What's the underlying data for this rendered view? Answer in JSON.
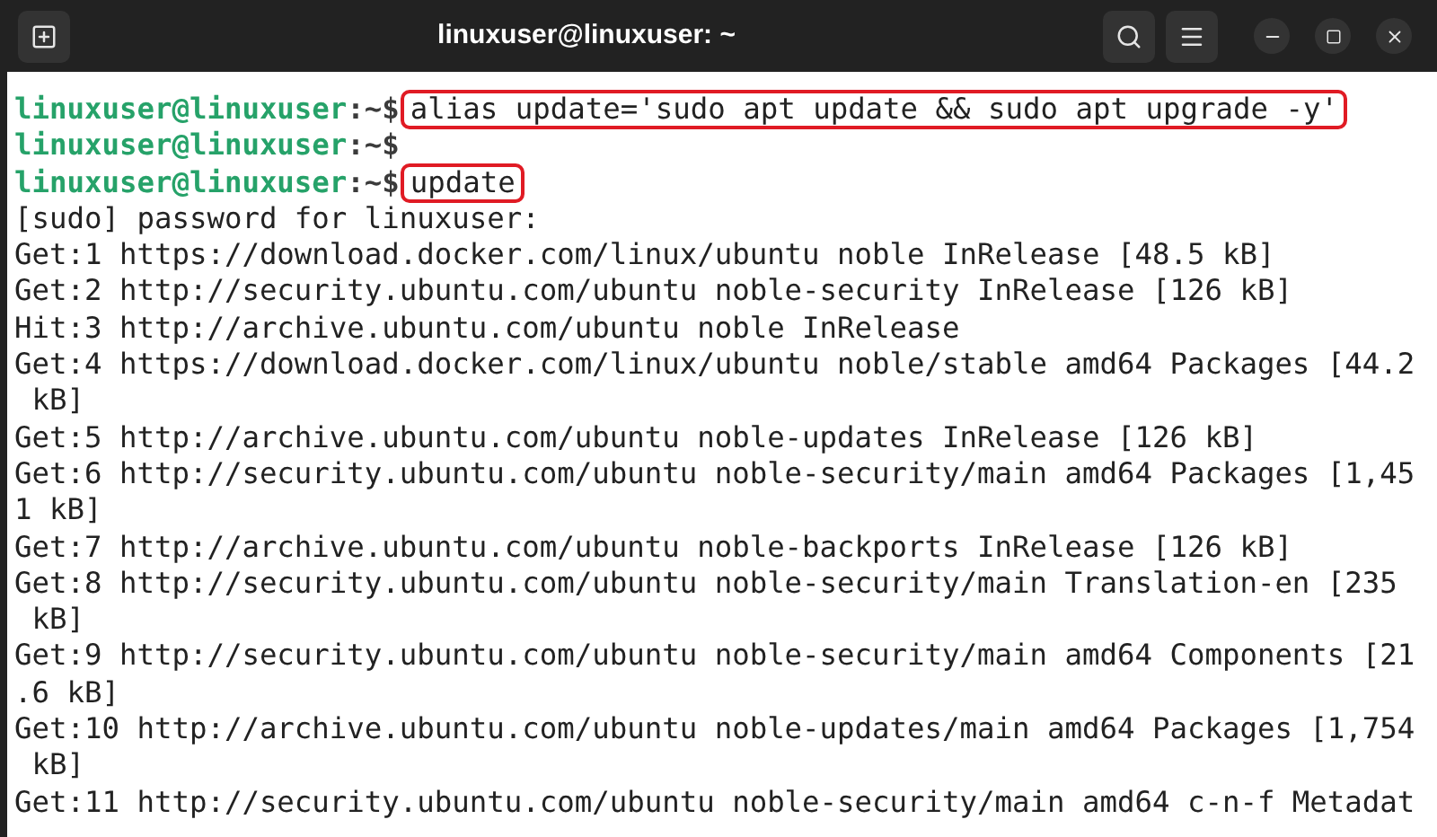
{
  "window": {
    "title": "linuxuser@linuxuser: ~"
  },
  "terminal": {
    "lines": [
      {
        "kind": "prompt",
        "user_host": "linuxuser@linuxuser",
        "path": ":~$",
        "command": "alias update='sudo apt update && sudo apt upgrade -y'",
        "highlighted": true
      },
      {
        "kind": "prompt",
        "user_host": "linuxuser@linuxuser",
        "path": ":~$"
      },
      {
        "kind": "prompt",
        "user_host": "linuxuser@linuxuser",
        "path": ":~$",
        "command": "update",
        "highlighted": true
      },
      {
        "kind": "output",
        "text": "[sudo] password for linuxuser:"
      },
      {
        "kind": "output",
        "text": "Get:1 https://download.docker.com/linux/ubuntu noble InRelease [48.5 kB]"
      },
      {
        "kind": "output",
        "text": "Get:2 http://security.ubuntu.com/ubuntu noble-security InRelease [126 kB]"
      },
      {
        "kind": "output",
        "text": "Hit:3 http://archive.ubuntu.com/ubuntu noble InRelease"
      },
      {
        "kind": "output",
        "text": "Get:4 https://download.docker.com/linux/ubuntu noble/stable amd64 Packages [44.2"
      },
      {
        "kind": "output",
        "text": " kB]"
      },
      {
        "kind": "output",
        "text": "Get:5 http://archive.ubuntu.com/ubuntu noble-updates InRelease [126 kB]"
      },
      {
        "kind": "output",
        "text": "Get:6 http://security.ubuntu.com/ubuntu noble-security/main amd64 Packages [1,45"
      },
      {
        "kind": "output",
        "text": "1 kB]"
      },
      {
        "kind": "output",
        "text": "Get:7 http://archive.ubuntu.com/ubuntu noble-backports InRelease [126 kB]"
      },
      {
        "kind": "output",
        "text": "Get:8 http://security.ubuntu.com/ubuntu noble-security/main Translation-en [235"
      },
      {
        "kind": "output",
        "text": " kB]"
      },
      {
        "kind": "output",
        "text": "Get:9 http://security.ubuntu.com/ubuntu noble-security/main amd64 Components [21"
      },
      {
        "kind": "output",
        "text": ".6 kB]"
      },
      {
        "kind": "output",
        "text": "Get:10 http://archive.ubuntu.com/ubuntu noble-updates/main amd64 Packages [1,754"
      },
      {
        "kind": "output",
        "text": " kB]"
      },
      {
        "kind": "output",
        "text": "Get:11 http://security.ubuntu.com/ubuntu noble-security/main amd64 c-n-f Metadat"
      }
    ]
  }
}
